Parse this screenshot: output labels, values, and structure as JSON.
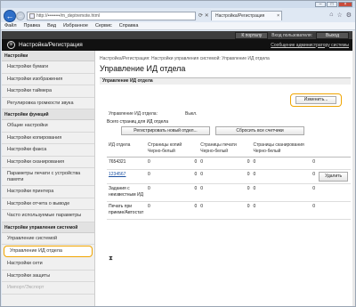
{
  "browser": {
    "address": "http://••••••••/m_deptremote.html",
    "tab_title": "Настройка/Регистрация",
    "tab_close": "×",
    "menu": [
      "Файл",
      "Правка",
      "Вид",
      "Избранное",
      "Сервис",
      "Справка"
    ],
    "window_controls": [
      "–",
      "□",
      "×"
    ],
    "back_glyph": "←",
    "forward_glyph": "→",
    "icons": [
      "home-icon",
      "star-icon",
      "gear-icon"
    ]
  },
  "appbar": {
    "portal": "К порталу",
    "user": "Вход пользователя:",
    "logout": "Выход"
  },
  "header": {
    "title": "Настройка/Регистрация",
    "admin_link": "Сообщение администратору системы"
  },
  "sidebar": {
    "group1": "Настройки",
    "items1": [
      "Настройки бумаги",
      "Настройки изображения",
      "Настройки таймера",
      "Регулировка громкости звука"
    ],
    "group2": "Настройки функций",
    "items2": [
      "Общие настройки",
      "Настройки копирования",
      "Настройки факса",
      "Настройки сканирования"
    ],
    "item_two_line": "Параметры печати с устройства памяти",
    "items3": [
      "Настройки принтера",
      "Настройки отчета о выводе",
      "Часто используемые параметры"
    ],
    "group3": "Настройки управления системой",
    "items4": [
      "Управление системой",
      "Управление ИД отдела",
      "Настройки сети",
      "Настройки защиты",
      "Импорт/Экспорт"
    ]
  },
  "main": {
    "breadcrumb": "Настройка/Регистрация: Настройки управления системой: Управление ИД отдела",
    "title": "Управление ИД отдела",
    "section": "Управление ИД отдела",
    "change_button": "Изменить...",
    "mgmt_label": "Управление ИД отдела:",
    "mgmt_value": "Выкл.",
    "all_pages": "Всего страниц для ИД отдела",
    "register_button": "Регистрировать новый отдел...",
    "reset_button": "Сбросить все счетчики",
    "sort_icon": "⧗"
  },
  "table": {
    "headers": [
      "ИД отдела",
      "Страницы копий\nЧерно-белый",
      "Страницы печати\nЧерно-белый",
      "Страницы сканирования\nЧерно-белый",
      ""
    ],
    "rows": [
      {
        "id": "7654321",
        "copy": "0",
        "c0": "0",
        "print": "0",
        "p0": "0",
        "scan": "0",
        "s0": "0",
        "action": ""
      },
      {
        "id": "1234567",
        "copy": "0",
        "c0": "0",
        "print": "0",
        "p0": "0",
        "scan": "0",
        "s0": "0",
        "action": "Удалить"
      },
      {
        "id": "Задания с неизвестным ИД",
        "copy": "0",
        "c0": "0",
        "print": "0",
        "p0": "0",
        "scan": "0",
        "s0": "0",
        "action": ""
      },
      {
        "id": "Печать при приеме/Автостат",
        "copy": "0",
        "c0": "0",
        "print": "0",
        "p0": "0",
        "scan": "0",
        "s0": "0",
        "action": ""
      }
    ]
  }
}
